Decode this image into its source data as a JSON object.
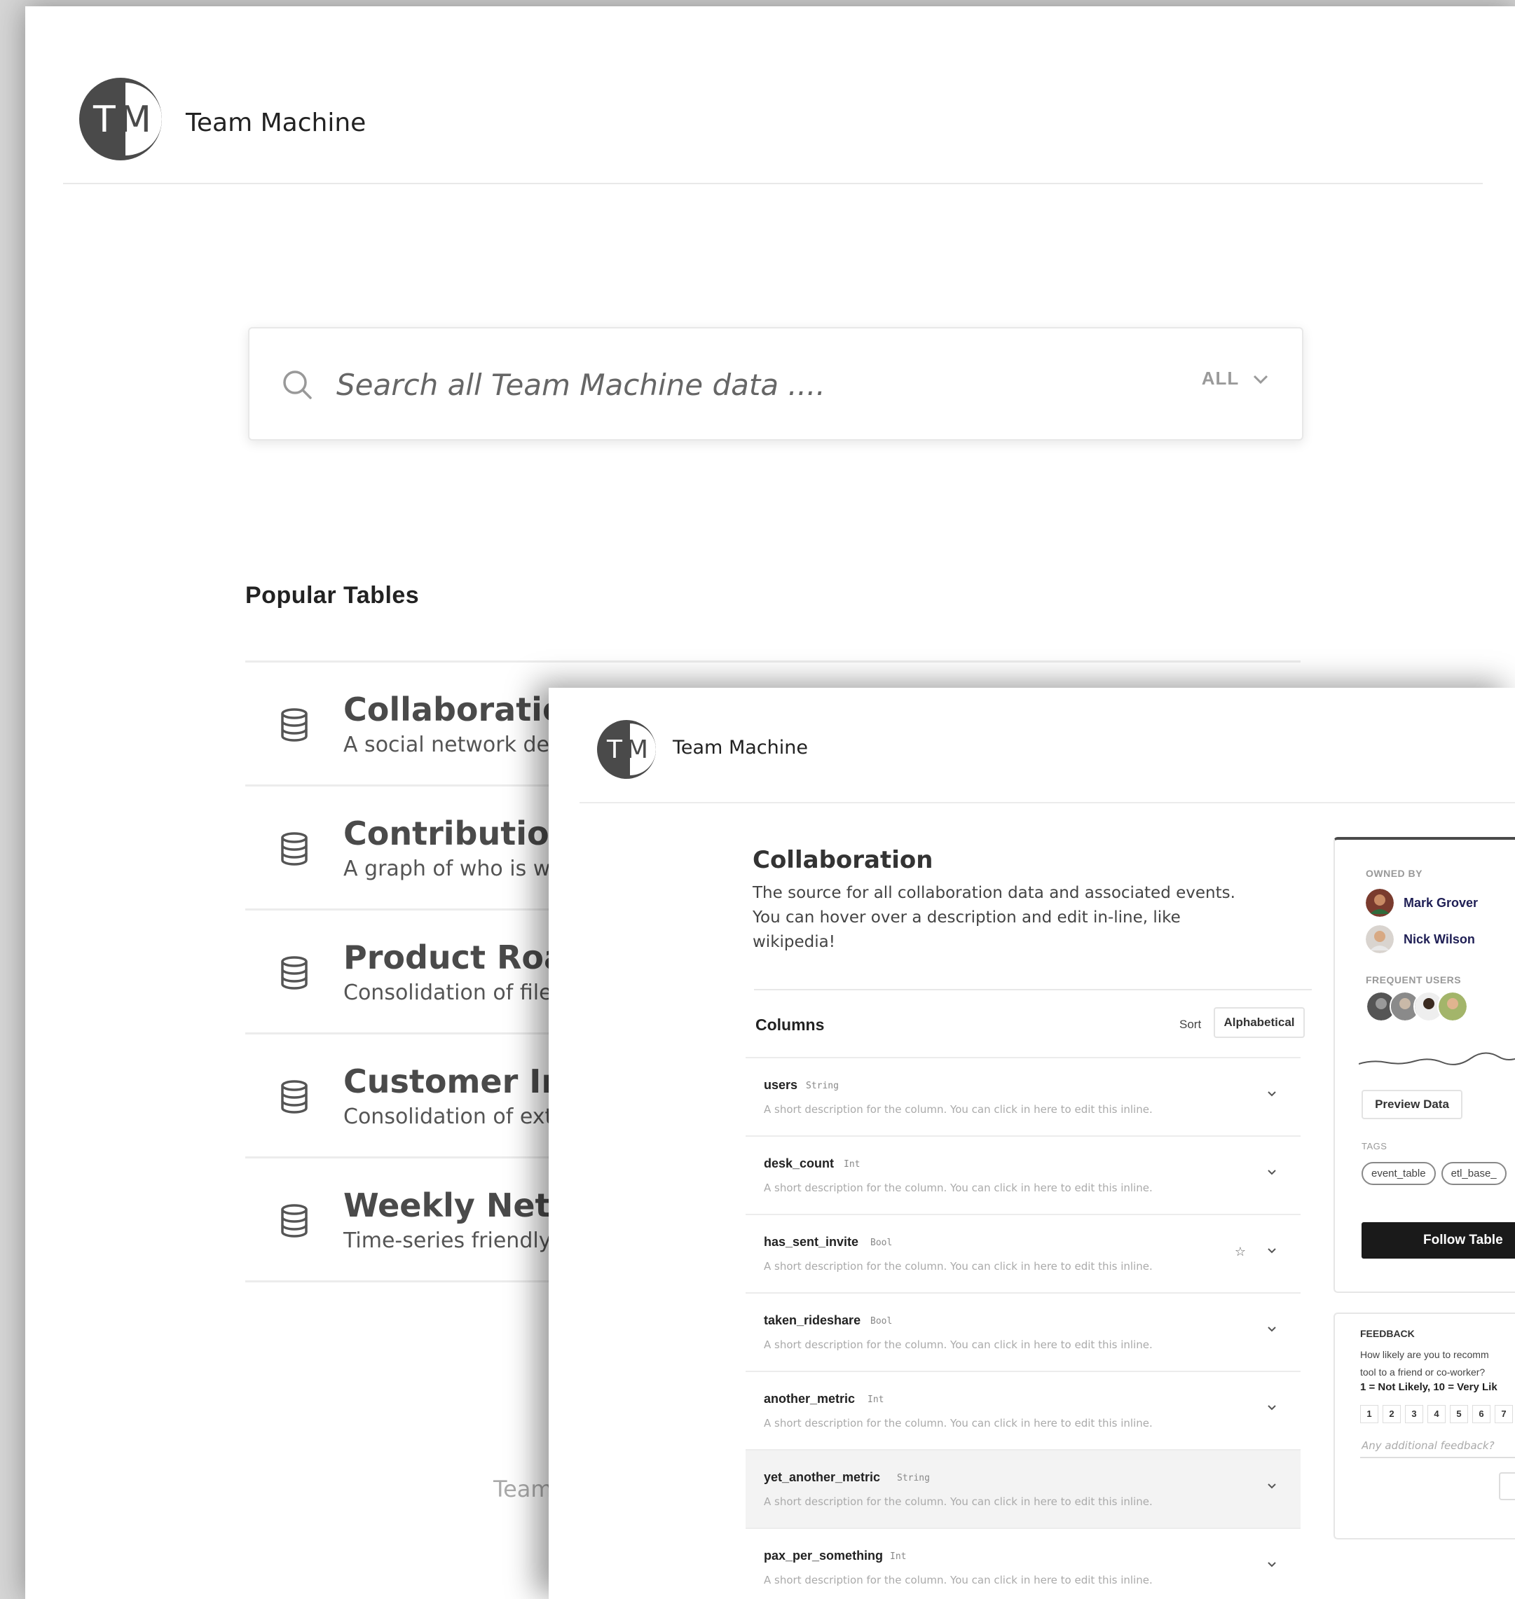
{
  "back": {
    "brand": "Team Machine",
    "logo_letters": {
      "t": "T",
      "m": "M"
    },
    "search": {
      "placeholder": "Search all Team Machine data ....",
      "filter_label": "ALL"
    },
    "popular_title": "Popular Tables",
    "popular_tables": [
      {
        "name": "Collaboration G",
        "desc": "A social network defin"
      },
      {
        "name": "Contribution G",
        "desc": "A graph of who is worl"
      },
      {
        "name": "Product Roadm",
        "desc": "Consolidation of files c"
      },
      {
        "name": "Customer Inter",
        "desc": "Consolidation of extern"
      },
      {
        "name": "Weekly Networ",
        "desc": "Time-series friendly da"
      }
    ],
    "footer": "Team"
  },
  "front": {
    "brand": "Team Machine",
    "logo_letters": {
      "t": "T",
      "m": "M"
    },
    "table_title": "Collaboration",
    "table_desc": "The source for all collaboration data and associated events. You can hover over a description and edit in-line, like wikipedia!",
    "columns_label": "Columns",
    "sort_label": "Sort",
    "sort_value": "Alphabetical",
    "columns": [
      {
        "name": "users",
        "type": "String",
        "desc": "A short description for the column. You can click in here to edit this inline."
      },
      {
        "name": "desk_count",
        "type": "Int",
        "desc": "A short description for the column. You can click in here to edit this inline."
      },
      {
        "name": "has_sent_invite",
        "type": "Bool",
        "desc": "A short description for the column. You can click in here to edit this inline."
      },
      {
        "name": "taken_rideshare",
        "type": "Bool",
        "desc": "A short description for the column. You can click in here to edit this inline."
      },
      {
        "name": "another_metric",
        "type": "Int",
        "desc": "A short description for the column. You can click in here to edit this inline."
      },
      {
        "name": "yet_another_metric",
        "type": "String",
        "desc": "A short description for the column. You can click in here to edit this inline."
      },
      {
        "name": "pax_per_something",
        "type": "Int",
        "desc": "A short description for the column. You can click in here to edit this inline."
      }
    ],
    "side": {
      "owned_by_label": "OWNED BY",
      "owners": [
        "Mark Grover",
        "Nick Wilson"
      ],
      "frequent_users_label": "FREQUENT USERS",
      "preview_button": "Preview Data",
      "tags_label": "TAGS",
      "tags": [
        "event_table",
        "etl_base_"
      ],
      "follow_button": "Follow Table"
    },
    "feedback": {
      "label": "FEEDBACK",
      "question_line1": "How likely are you to recomm",
      "question_line2": "tool to a friend or co-worker?",
      "scale": "1 = Not Likely, 10 = Very Lik",
      "numbers": [
        "1",
        "2",
        "3",
        "4",
        "5",
        "6",
        "7"
      ],
      "input_placeholder": "Any additional feedback?"
    }
  },
  "colors": {
    "logo_dark": "#4a4a4a",
    "follow_button_bg": "#1a1a1a",
    "owner_name": "#1f1f55",
    "highlight_row": "#f3f3f3"
  }
}
